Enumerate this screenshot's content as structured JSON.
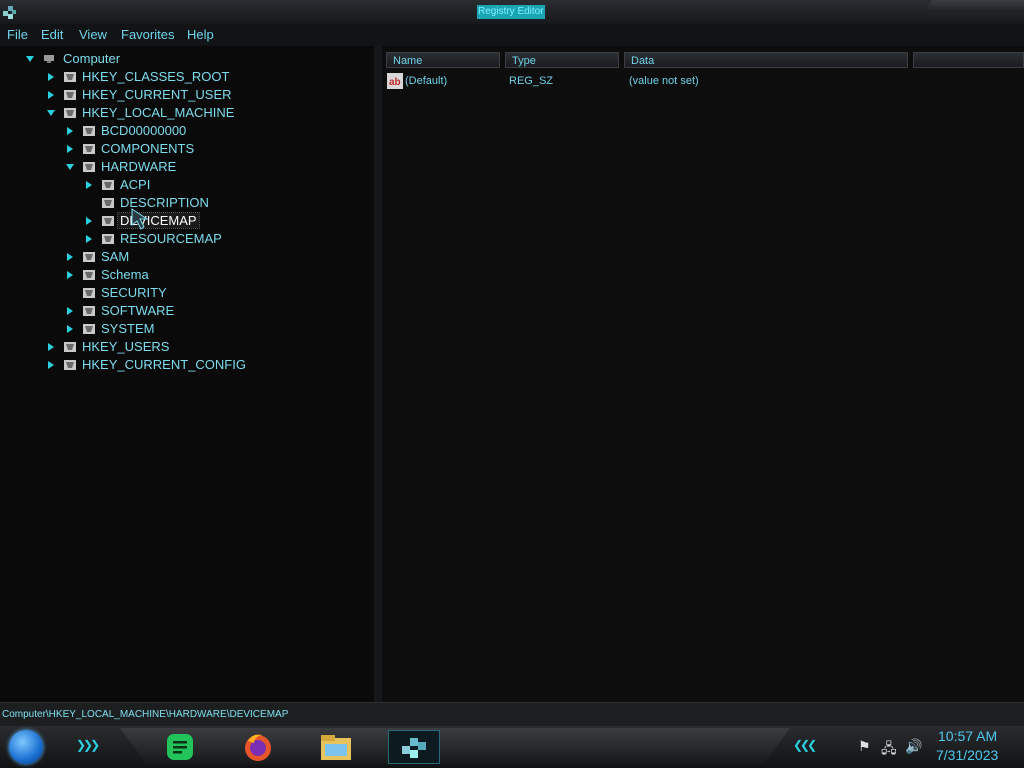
{
  "window": {
    "title": "Registry Editor"
  },
  "menu": [
    "File",
    "Edit",
    "View",
    "Favorites",
    "Help"
  ],
  "tree": [
    {
      "label": "Computer",
      "level": 0,
      "expanded": true
    },
    {
      "label": "HKEY_CLASSES_ROOT",
      "level": 1,
      "expanded": false
    },
    {
      "label": "HKEY_CURRENT_USER",
      "level": 1,
      "expanded": false
    },
    {
      "label": "HKEY_LOCAL_MACHINE",
      "level": 1,
      "expanded": true
    },
    {
      "label": "BCD00000000",
      "level": 2,
      "expanded": false
    },
    {
      "label": "COMPONENTS",
      "level": 2,
      "expanded": false
    },
    {
      "label": "HARDWARE",
      "level": 2,
      "expanded": true
    },
    {
      "label": "ACPI",
      "level": 3,
      "expanded": false
    },
    {
      "label": "DESCRIPTION",
      "level": 3,
      "expanded": null
    },
    {
      "label": "DEVICEMAP",
      "level": 3,
      "expanded": false,
      "selected": true
    },
    {
      "label": "RESOURCEMAP",
      "level": 3,
      "expanded": false
    },
    {
      "label": "SAM",
      "level": 2,
      "expanded": false
    },
    {
      "label": "Schema",
      "level": 2,
      "expanded": false
    },
    {
      "label": "SECURITY",
      "level": 2,
      "expanded": null
    },
    {
      "label": "SOFTWARE",
      "level": 2,
      "expanded": false
    },
    {
      "label": "SYSTEM",
      "level": 2,
      "expanded": false
    },
    {
      "label": "HKEY_USERS",
      "level": 1,
      "expanded": false
    },
    {
      "label": "HKEY_CURRENT_CONFIG",
      "level": 1,
      "expanded": false
    }
  ],
  "list": {
    "columns": [
      "Name",
      "Type",
      "Data"
    ],
    "rows": [
      {
        "name": "(Default)",
        "type": "REG_SZ",
        "data": "(value not set)",
        "icon": "string-value-icon"
      }
    ]
  },
  "status": {
    "path": "Computer\\HKEY_LOCAL_MACHINE\\HARDWARE\\DEVICEMAP"
  },
  "taskbar": {
    "apps": [
      "notes-app-icon",
      "firefox-icon",
      "file-explorer-icon",
      "registry-editor-icon"
    ],
    "clock_time": "10:57 AM",
    "clock_date": "7/31/2023"
  },
  "colors": {
    "accent": "#2bd1e0",
    "text": "#7cdcee",
    "background": "#0a0a0a"
  }
}
